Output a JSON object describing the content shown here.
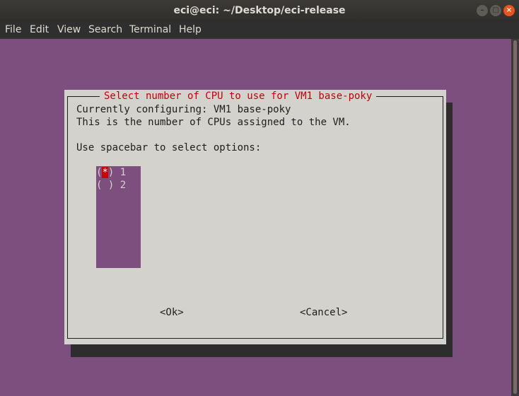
{
  "window": {
    "title": "eci@eci: ~/Desktop/eci-release"
  },
  "menu": [
    "File",
    "Edit",
    "View",
    "Search",
    "Terminal",
    "Help"
  ],
  "dialog": {
    "title": "Select number of CPU to use for VM1 base-poky",
    "lines": [
      "Currently configuring: VM1 base-poky",
      "This is the number of CPUs assigned to the VM.",
      "",
      "Use spacebar to select options:"
    ],
    "options": [
      {
        "mark": "*",
        "label": "1",
        "selected": true
      },
      {
        "mark": " ",
        "label": "2",
        "selected": false
      }
    ],
    "ok_label": "<Ok>",
    "cancel_label": "<Cancel>"
  },
  "colors": {
    "terminal_bg": "#7c4f7f",
    "dialog_bg": "#d3d2cd",
    "title_red": "#c4000a",
    "selection_red": "#cc0000"
  }
}
